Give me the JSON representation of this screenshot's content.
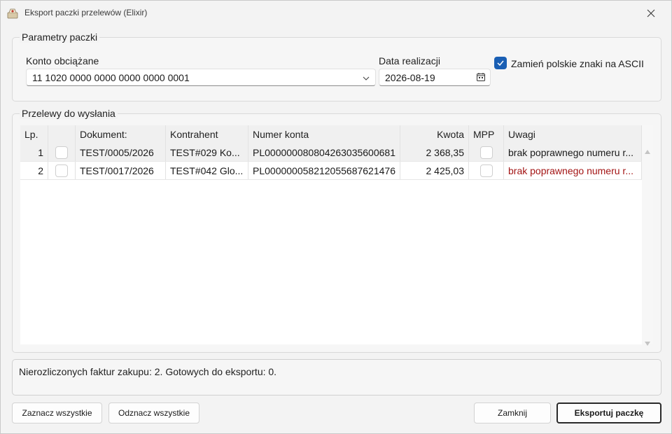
{
  "window": {
    "title": "Eksport paczki przelewów (Elixir)"
  },
  "params": {
    "group_title": "Parametry paczki",
    "account_label": "Konto obciążane",
    "account_value": "11 1020 0000 0000 0000 0000 0001",
    "date_label": "Data realizacji",
    "date_value": "2026-08-19",
    "ascii_label": "Zamień polskie znaki na ASCII",
    "ascii_checked": true
  },
  "transfers": {
    "group_title": "Przelewy do wysłania",
    "columns": [
      "Lp.",
      "",
      "Dokument:",
      "Kontrahent",
      "Numer konta",
      "Kwota",
      "MPP",
      "Uwagi"
    ],
    "rows": [
      {
        "lp": "1",
        "checked": false,
        "dokument": "TEST/0005/2026",
        "kontrahent": "TEST#029 Ko...",
        "numer_konta": "PL00000008080426303560068​1",
        "kwota": "2 368,35",
        "mpp": false,
        "uwagi": "brak poprawnego numeru r...",
        "uwagi_color": "#1f1f1f"
      },
      {
        "lp": "2",
        "checked": false,
        "dokument": "TEST/0017/2026",
        "kontrahent": "TEST#042 Glo...",
        "numer_konta": "PL00000005821205568762147​6",
        "kwota": "2 425,03",
        "mpp": false,
        "uwagi": "brak poprawnego numeru r...",
        "uwagi_color": "#a31515"
      }
    ]
  },
  "status": {
    "text": "Nierozliczonych faktur zakupu: 2. Gotowych do eksportu: 0."
  },
  "buttons": {
    "select_all": "Zaznacz wszystkie",
    "deselect_all": "Odznacz wszystkie",
    "close": "Zamknij",
    "export": "Eksportuj paczkę"
  },
  "colors": {
    "accent": "#1a5fb4",
    "warning_text": "#a31515"
  }
}
